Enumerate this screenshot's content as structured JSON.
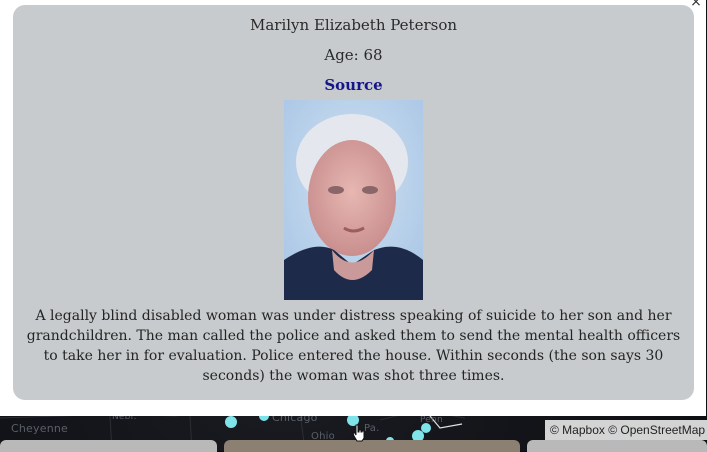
{
  "map": {
    "labels": [
      "Cheyenne",
      "Nebr.",
      "Chicago",
      "Ohio",
      "Pa.",
      "Penn"
    ],
    "attribution": "© Mapbox © OpenStreetMap",
    "marker_color": "#7fe3ea"
  },
  "popup": {
    "close_label": "×",
    "name": "Marilyn Elizabeth Peterson",
    "age": "Age: 68",
    "source_label": "Source",
    "photo_alt": "Portrait photo",
    "description": "A legally blind disabled woman was under distress speaking of suicide to her son and her grandchildren. The man called the police and asked them to send the mental health officers to take her in for evaluation. Police entered the house. Within seconds (the son says 30 seconds) the woman was shot three times."
  },
  "colors": {
    "card_bg": "#c8cbcd",
    "link": "#16168a",
    "map_bg": "#0e0f13"
  }
}
